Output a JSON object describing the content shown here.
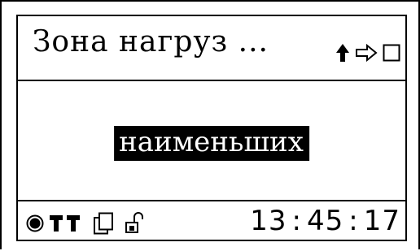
{
  "header": {
    "title": "Зона нагруз ...",
    "icons": [
      "arrow-up-icon",
      "arrow-right-outline-icon",
      "empty-square-icon"
    ]
  },
  "main": {
    "selected_value": "наименьших"
  },
  "status_bar": {
    "icons": [
      "record-icon",
      "signal-bars-icon",
      "copy-pages-icon",
      "unlock-icon"
    ],
    "time": {
      "hours": "13",
      "minutes": "45",
      "seconds": "17",
      "separator": ":"
    }
  }
}
